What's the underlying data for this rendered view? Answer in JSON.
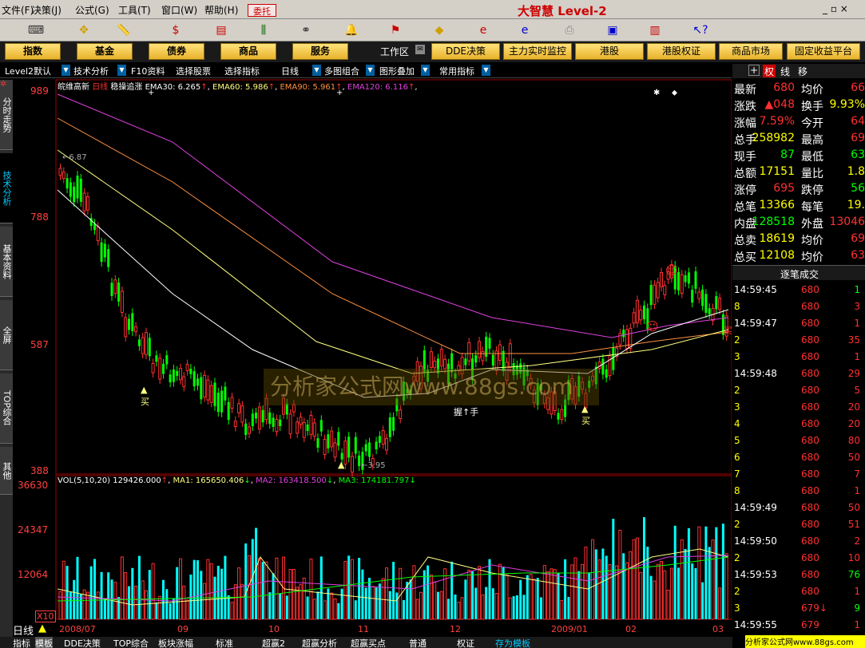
{
  "menu": {
    "items": [
      "文件(F)",
      "决策(J)",
      "公式(G)",
      "工具(T)",
      "窗口(W)",
      "帮助(H)"
    ],
    "trust": "委托",
    "brand": "大智慧 Level-2"
  },
  "nav": {
    "buttons": [
      "指数",
      "基金",
      "债券",
      "商品",
      "服务"
    ],
    "workspace": "工作区",
    "tools": [
      "DDE决策",
      "主力实时监控",
      "港股",
      "港股权证",
      "商品市场",
      "固定收益平台"
    ]
  },
  "subbar": {
    "items": [
      "Level2默认",
      "技术分析",
      "F10资料",
      "选择股票",
      "选择指标",
      "日线",
      "多图组合",
      "图形叠加",
      "常用指标"
    ]
  },
  "side_tabs": [
    "分时走势",
    "技术分析",
    "基本资料",
    "全屏",
    "TOP综合",
    "其他"
  ],
  "legend": {
    "stock": "皖维高新",
    "period": "日线",
    "signal": "稳操追涨",
    "ema30": "EMA30: 6.265",
    "ema60": "EMA60: 5.986",
    "ema90": "EMA90: 5.961",
    "ema120": "EMA120: 6.116"
  },
  "price_axis": [
    "989",
    "788",
    "587",
    "388"
  ],
  "annotations": {
    "high": "6.87",
    "low": "3.95",
    "buy": "买",
    "hold": "握↑手"
  },
  "watermark": "分析家公式网www.88gs.com",
  "vol_legend": {
    "vol": "VOL(5,10,20)",
    "value": "129426.000",
    "ma1": "MA1: 165650.406",
    "ma2": "MA2: 163418.500",
    "ma3": "MA3: 174181.797"
  },
  "vol_axis": [
    "36630",
    "24347",
    "12064",
    "X10"
  ],
  "date_axis": [
    "2008/07",
    "09",
    "10",
    "11",
    "12",
    "2009/01",
    "02",
    "03"
  ],
  "period_label": "日线",
  "bottom_tabs": [
    "指标",
    "模板",
    "DDE决策",
    "TOP综合",
    "板块涨幅",
    "标准",
    "超赢2",
    "超赢分析",
    "超赢买点",
    "普通",
    "权证",
    "存为模板"
  ],
  "quote": [
    {
      "k": "最新",
      "v": "680",
      "k2": "均价",
      "v2": "66",
      "vc": "red",
      "v2c": "red"
    },
    {
      "k": "涨跌",
      "v": "▲048",
      "k2": "换手",
      "v2": "9.93%",
      "vc": "red",
      "v2c": "yel"
    },
    {
      "k": "涨幅",
      "v": "7.59%",
      "k2": "今开",
      "v2": "64",
      "vc": "red",
      "v2c": "red"
    },
    {
      "k": "总手",
      "v": "258982",
      "k2": "最高",
      "v2": "69",
      "vc": "yel",
      "v2c": "red"
    },
    {
      "k": "现手",
      "v": "87",
      "k2": "最低",
      "v2": "63",
      "vc": "grn",
      "v2c": "grn"
    },
    {
      "k": "总额",
      "v": "17151",
      "k2": "量比",
      "v2": "1.8",
      "vc": "yel",
      "v2c": "yel"
    },
    {
      "k": "涨停",
      "v": "695",
      "k2": "跌停",
      "v2": "56",
      "vc": "red",
      "v2c": "grn"
    },
    {
      "k": "总笔",
      "v": "13366",
      "k2": "每笔",
      "v2": "19.",
      "vc": "yel",
      "v2c": "yel"
    },
    {
      "k": "内盘",
      "v": "128518",
      "k2": "外盘",
      "v2": "13046",
      "vc": "grn",
      "v2c": "red"
    },
    {
      "k": "总卖",
      "v": "18619",
      "k2": "均价",
      "v2": "69",
      "vc": "yel",
      "v2c": "red"
    },
    {
      "k": "总买",
      "v": "12108",
      "k2": "均价",
      "v2": "63",
      "vc": "yel",
      "v2c": "red"
    }
  ],
  "tick_header": "逐笔成交",
  "tick_tabs": [
    "权",
    "线",
    "移"
  ],
  "ticks": [
    {
      "t": "14:59:45",
      "p": "680",
      "q": "1",
      "c": "grn"
    },
    {
      "t": "8",
      "p": "680",
      "q": "3",
      "c": "red"
    },
    {
      "t": "14:59:47",
      "p": "680",
      "q": "1",
      "c": "red"
    },
    {
      "t": "2",
      "p": "680",
      "q": "35",
      "c": "red"
    },
    {
      "t": "3",
      "p": "680",
      "q": "1",
      "c": "red"
    },
    {
      "t": "14:59:48",
      "p": "680",
      "q": "29",
      "c": "red"
    },
    {
      "t": "2",
      "p": "680",
      "q": "5",
      "c": "red"
    },
    {
      "t": "3",
      "p": "680",
      "q": "20",
      "c": "red"
    },
    {
      "t": "4",
      "p": "680",
      "q": "20",
      "c": "red"
    },
    {
      "t": "5",
      "p": "680",
      "q": "80",
      "c": "red"
    },
    {
      "t": "6",
      "p": "680",
      "q": "50",
      "c": "red"
    },
    {
      "t": "7",
      "p": "680",
      "q": "7",
      "c": "red"
    },
    {
      "t": "8",
      "p": "680",
      "q": "1",
      "c": "red"
    },
    {
      "t": "14:59:49",
      "p": "680",
      "q": "50",
      "c": "red"
    },
    {
      "t": "2",
      "p": "680",
      "q": "51",
      "c": "red"
    },
    {
      "t": "14:59:50",
      "p": "680",
      "q": "2",
      "c": "red"
    },
    {
      "t": "2",
      "p": "680",
      "q": "10",
      "c": "red"
    },
    {
      "t": "14:59:53",
      "p": "680",
      "q": "76",
      "c": "grn"
    },
    {
      "t": "2",
      "p": "680",
      "q": "1",
      "c": "red"
    },
    {
      "t": "3",
      "p": "679↓",
      "q": "9",
      "c": "grn"
    },
    {
      "t": "14:59:55",
      "p": "679",
      "q": "1",
      "c": "red"
    }
  ],
  "corner": "分析家公式网www.88gs.com",
  "colors": {
    "up": "#ff3030",
    "down": "#00ff00",
    "bg": "#000000",
    "axis": "#c00000"
  }
}
